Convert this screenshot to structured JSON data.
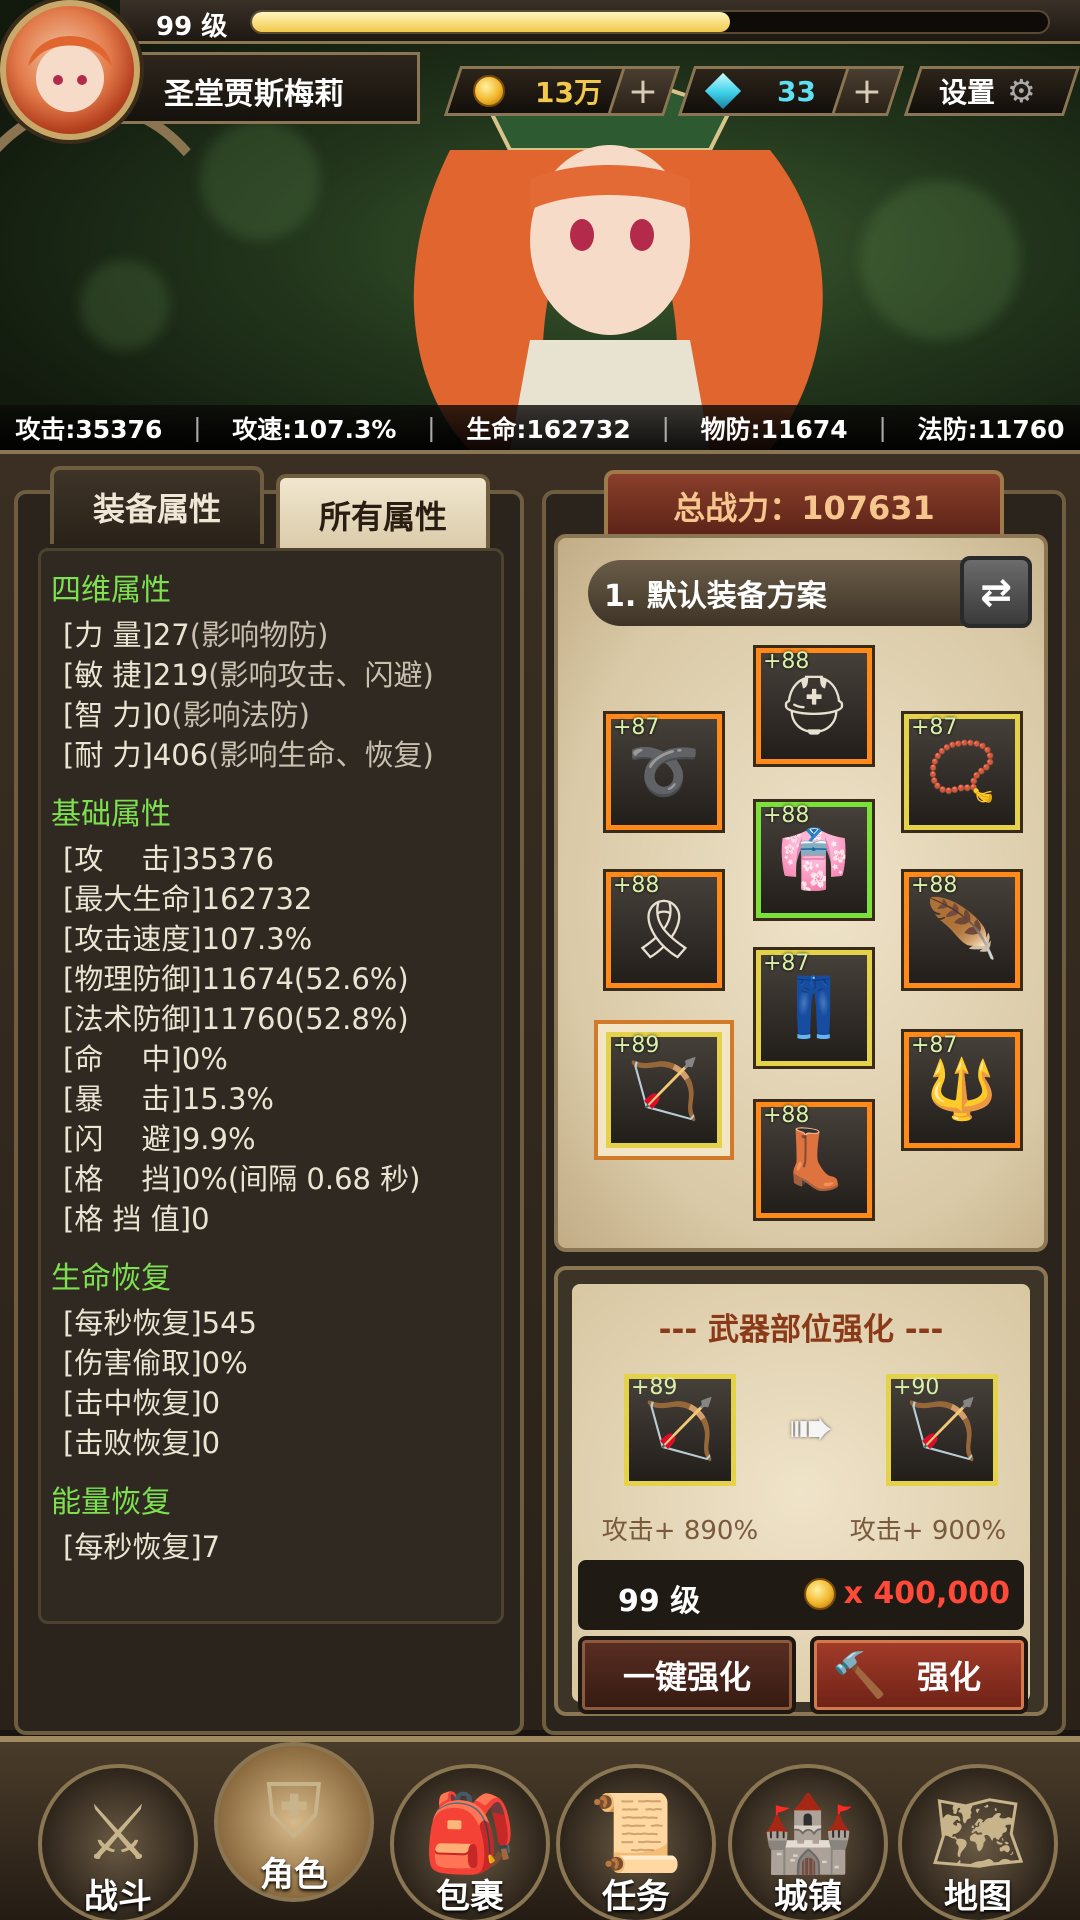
{
  "header": {
    "level": "99 级",
    "xp_fraction": 0.6,
    "name": "圣堂贾斯梅莉",
    "gold": "13万",
    "gems": "33",
    "settings_label": "设置"
  },
  "stats_bar": [
    "攻击:35376",
    "攻速:107.3%",
    "生命:162732",
    "物防:11674",
    "法防:11760"
  ],
  "tabs": {
    "equip_attr": "装备属性",
    "all_attr": "所有属性"
  },
  "attributes": [
    {
      "title": "四维属性",
      "rows": [
        {
          "label": "[力 量]",
          "value": "27",
          "note": "(影响物防)"
        },
        {
          "label": "[敏 捷]",
          "value": "219",
          "note": "(影响攻击、闪避)"
        },
        {
          "label": "[智 力]",
          "value": "0",
          "note": "(影响法防)"
        },
        {
          "label": "[耐 力]",
          "value": "406",
          "note": "(影响生命、恢复)"
        }
      ]
    },
    {
      "title": "基础属性",
      "rows": [
        {
          "label": "[攻　 击]",
          "value": "35376",
          "note": ""
        },
        {
          "label": "[最大生命]",
          "value": "162732",
          "note": ""
        },
        {
          "label": "[攻击速度]",
          "value": "107.3%",
          "note": ""
        },
        {
          "label": "[物理防御]",
          "value": "11674(52.6%)",
          "note": ""
        },
        {
          "label": "[法术防御]",
          "value": "11760(52.8%)",
          "note": ""
        },
        {
          "label": "[命　 中]",
          "value": "0%",
          "note": ""
        },
        {
          "label": "[暴　 击]",
          "value": "15.3%",
          "note": ""
        },
        {
          "label": "[闪　 避]",
          "value": "9.9%",
          "note": ""
        },
        {
          "label": "[格　 挡]",
          "value": "0%(间隔 0.68 秒)",
          "note": ""
        },
        {
          "label": "[格 挡 值]",
          "value": "0",
          "note": ""
        }
      ]
    },
    {
      "title": "生命恢复",
      "rows": [
        {
          "label": "[每秒恢复]",
          "value": "545",
          "note": ""
        },
        {
          "label": "[伤害偷取]",
          "value": "0%",
          "note": ""
        },
        {
          "label": "[击中恢复]",
          "value": "0",
          "note": ""
        },
        {
          "label": "[击败恢复]",
          "value": "0",
          "note": ""
        }
      ]
    },
    {
      "title": "能量恢复",
      "rows": [
        {
          "label": "[每秒恢复]",
          "value": "7",
          "note": ""
        }
      ]
    }
  ],
  "power": {
    "label": "总战力：107631"
  },
  "loadout": {
    "name": "1. 默认装备方案"
  },
  "equipment": [
    {
      "slot": "helmet",
      "level": "+88",
      "icon": "helmet-icon",
      "glyph": "⛑"
    },
    {
      "slot": "ring",
      "level": "+87",
      "icon": "ring-icon",
      "glyph": "➰"
    },
    {
      "slot": "necklace",
      "level": "+87",
      "icon": "necklace-icon",
      "glyph": "📿"
    },
    {
      "slot": "armor",
      "level": "+88",
      "icon": "armor-icon",
      "glyph": "👘"
    },
    {
      "slot": "belt",
      "level": "+88",
      "icon": "belt-icon",
      "glyph": "🎗"
    },
    {
      "slot": "shoulder",
      "level": "+88",
      "icon": "shoulder-icon",
      "glyph": "🪶"
    },
    {
      "slot": "pants",
      "level": "+87",
      "icon": "pants-icon",
      "glyph": "👖"
    },
    {
      "slot": "weapon",
      "level": "+89",
      "icon": "bow-icon",
      "glyph": "🏹"
    },
    {
      "slot": "amulet",
      "level": "+87",
      "icon": "amulet-icon",
      "glyph": "🔱"
    },
    {
      "slot": "boots",
      "level": "+88",
      "icon": "boots-icon",
      "glyph": "👢"
    }
  ],
  "upgrade": {
    "title": "--- 武器部位强化 ---",
    "from_level": "+89",
    "to_level": "+90",
    "from_note": "攻击+ 890%",
    "to_note": "攻击+ 900%",
    "req_level": "99 级",
    "cost": "x 400,000"
  },
  "buttons": {
    "one_click": "一键强化",
    "upgrade": "强化"
  },
  "nav": [
    {
      "label": "战斗",
      "icon": "battle-icon",
      "glyph": "⚔"
    },
    {
      "label": "角色",
      "icon": "helmet-icon",
      "glyph": "⛨"
    },
    {
      "label": "包裹",
      "icon": "bag-icon",
      "glyph": "🎒"
    },
    {
      "label": "任务",
      "icon": "scroll-icon",
      "glyph": "📜"
    },
    {
      "label": "城镇",
      "icon": "tower-icon",
      "glyph": "🏰"
    },
    {
      "label": "地图",
      "icon": "map-icon",
      "glyph": "🗺"
    }
  ],
  "colors": {
    "accent_green": "#7de04e",
    "cost_red": "#ff4a3a",
    "orange_border": "#ff8a1a",
    "green_border": "#7be03a",
    "yellow_border": "#e4d24a"
  }
}
